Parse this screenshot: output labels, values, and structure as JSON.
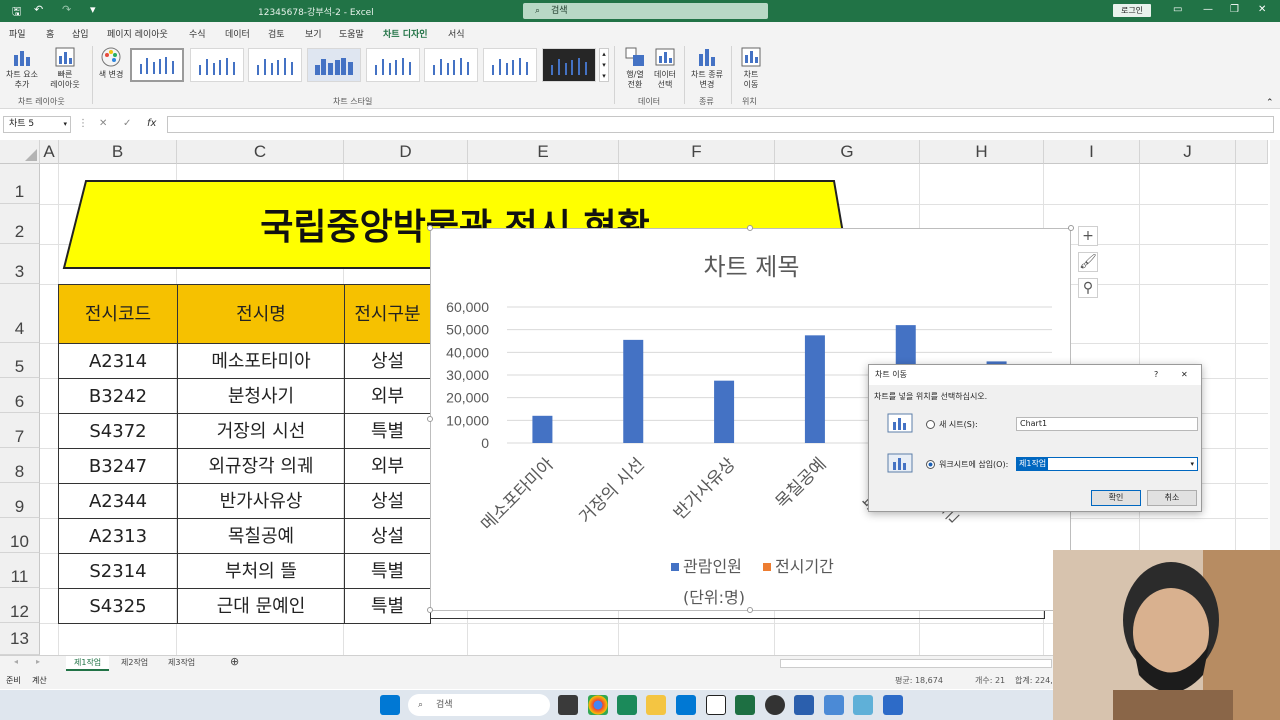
{
  "titlebar": {
    "doc_title": "12345678-강부석-2  -  Excel",
    "search_placeholder": "검색",
    "login": "로그인"
  },
  "menu": {
    "tabs": [
      "파일",
      "홈",
      "삽입",
      "페이지 레이아웃",
      "수식",
      "데이터",
      "검토",
      "보기",
      "도움말",
      "차트 디자인",
      "서식"
    ],
    "share": "공유"
  },
  "ribbon": {
    "add_element": "차트 요소\n추가",
    "quick_layout": "빠른\n레이아웃",
    "group_layout": "차트 레이아웃",
    "change_color": "색 변경",
    "group_styles": "차트 스타일",
    "switch_row_col": "행/열\n전환",
    "select_data": "데이터\n선택",
    "group_data": "데이터",
    "change_type": "차트 종류\n변경",
    "group_type": "종류",
    "move_chart": "차트\n이동",
    "group_location": "위치"
  },
  "formula": {
    "namebox": "차트 5",
    "fx": "fx"
  },
  "columns": [
    "A",
    "B",
    "C",
    "D",
    "E",
    "F",
    "G",
    "H",
    "I",
    "J"
  ],
  "rows": [
    "1",
    "2",
    "3",
    "4",
    "5",
    "6",
    "7",
    "8",
    "9",
    "10",
    "11",
    "12",
    "13"
  ],
  "banner_title": "국립중앙박물관 전시 현황",
  "table": {
    "headers": [
      "전시코드",
      "전시명",
      "전시구분"
    ],
    "rows": [
      [
        "A2314",
        "메소포타미아",
        "상설"
      ],
      [
        "B3242",
        "분청사기",
        "외부"
      ],
      [
        "S4372",
        "거장의 시선",
        "특별"
      ],
      [
        "B3247",
        "외규장각 의궤",
        "외부"
      ],
      [
        "A2344",
        "반가사유상",
        "상설"
      ],
      [
        "A2313",
        "목칠공예",
        "상설"
      ],
      [
        "S2314",
        "부처의 뜰",
        "특별"
      ],
      [
        "S4325",
        "근대 문예인",
        "특별"
      ]
    ]
  },
  "chart_data": {
    "type": "bar",
    "title": "차트 제목",
    "categories": [
      "메소포타미아",
      "거장의 시선",
      "반가사유상",
      "목칠공예",
      "부처의 뜰",
      "근대 문예인"
    ],
    "series": [
      {
        "name": "관람인원",
        "values": [
          12000,
          45500,
          27500,
          47500,
          52000,
          36000
        ],
        "color": "#4472c4"
      },
      {
        "name": "전시기간",
        "values": [
          0,
          0,
          0,
          0,
          0,
          0
        ],
        "color": "#ed7d31"
      }
    ],
    "yticks": [
      "60,000",
      "50,000",
      "40,000",
      "30,000",
      "20,000",
      "10,000",
      "0"
    ],
    "ylim": [
      0,
      60000
    ],
    "note": "(단위:명)",
    "legend": "bottom"
  },
  "dialog": {
    "title": "차트 이동",
    "help": "?",
    "close": "✕",
    "prompt": "차트를 넣을 위치를 선택하십시오.",
    "opt_new": "새 시트(S):",
    "opt_new_value": "Chart1",
    "opt_obj": "워크시트에 삽입(O):",
    "opt_obj_value": "제1작업",
    "ok": "확인",
    "cancel": "취소"
  },
  "sheets": [
    "제1작업",
    "제2작업",
    "제3작업"
  ],
  "status": {
    "ready": "준비",
    "calc": "계산",
    "avg": "평균: 18,674",
    "count": "개수: 21",
    "sum": "합계: 224,0"
  },
  "taskbar": {
    "search": "검색"
  }
}
